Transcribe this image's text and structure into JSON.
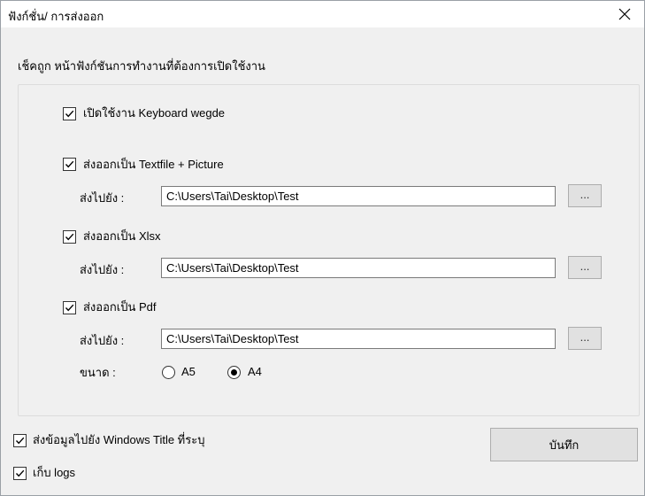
{
  "window": {
    "title": "ฟังก์ชั่น/ การส่งออก"
  },
  "instruction": "เช็คถูก หน้าฟังก์ชันการทำงานที่ต้องการเปิดใช้งาน",
  "options": {
    "keyboard_wedge": {
      "label": "เปิดใช้งาน Keyboard wegde",
      "checked": true
    },
    "export_textfile": {
      "label": "ส่งออกเป็น Textfile + Picture",
      "checked": true,
      "path_label": "ส่งไปยัง :",
      "path": "C:\\Users\\Tai\\Desktop\\Test",
      "browse_label": "..."
    },
    "export_xlsx": {
      "label": "ส่งออกเป็น Xlsx",
      "checked": true,
      "path_label": "ส่งไปยัง :",
      "path": "C:\\Users\\Tai\\Desktop\\Test",
      "browse_label": "..."
    },
    "export_pdf": {
      "label": "ส่งออกเป็น Pdf",
      "checked": true,
      "path_label": "ส่งไปยัง :",
      "path": "C:\\Users\\Tai\\Desktop\\Test",
      "browse_label": "...",
      "size_label": "ขนาด :",
      "sizes": [
        {
          "label": "A5",
          "selected": false
        },
        {
          "label": "A4",
          "selected": true
        }
      ]
    }
  },
  "bottom": {
    "send_to_window": {
      "label": "ส่งข้อมูลไปยัง Windows Title ที่ระบุ",
      "checked": true
    },
    "keep_logs": {
      "label": "เก็บ logs",
      "checked": true
    },
    "save_label": "บันทึก"
  },
  "icons": {
    "close": "close-icon",
    "check": "checkmark-icon"
  }
}
